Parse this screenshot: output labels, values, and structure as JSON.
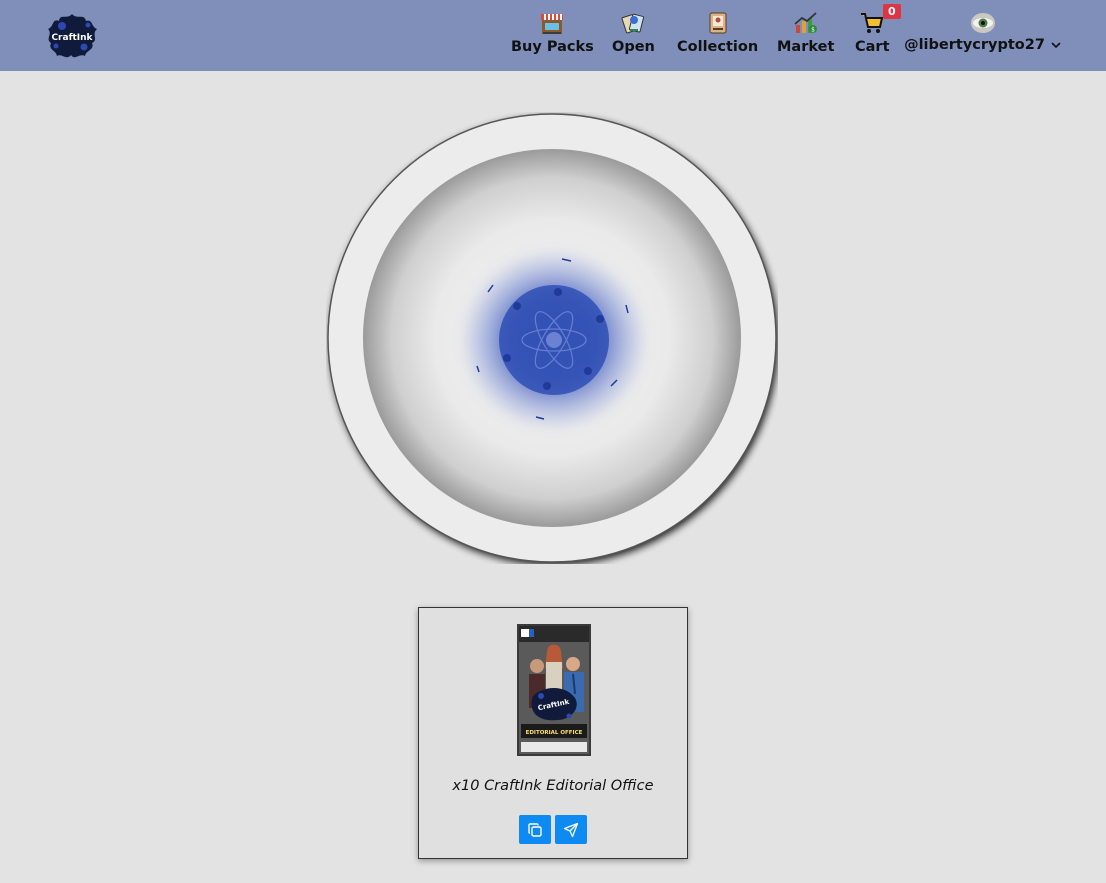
{
  "app": {
    "logo_text": "CraftInk"
  },
  "nav": {
    "buy_packs": {
      "label": "Buy Packs",
      "icon": "shop-icon"
    },
    "open": {
      "label": "Open",
      "icon": "open-packs-icon"
    },
    "collection": {
      "label": "Collection",
      "icon": "collection-icon"
    },
    "market": {
      "label": "Market",
      "icon": "market-icon"
    },
    "cart": {
      "label": "Cart",
      "icon": "cart-icon",
      "count": "0"
    }
  },
  "user": {
    "username": "@libertycrypto27",
    "icon": "eye-avatar-icon"
  },
  "pack": {
    "title": "x10 CraftInk Editorial Office",
    "image_text": "EDITORIAL OFFICE",
    "copy_icon": "copy-icon",
    "send_icon": "send-icon"
  },
  "colors": {
    "navbar": "#7f8fba",
    "background": "#e3e3e3",
    "button": "#0d8bf2",
    "badge": "#dc3545",
    "portal_glow": "#3352b8"
  }
}
